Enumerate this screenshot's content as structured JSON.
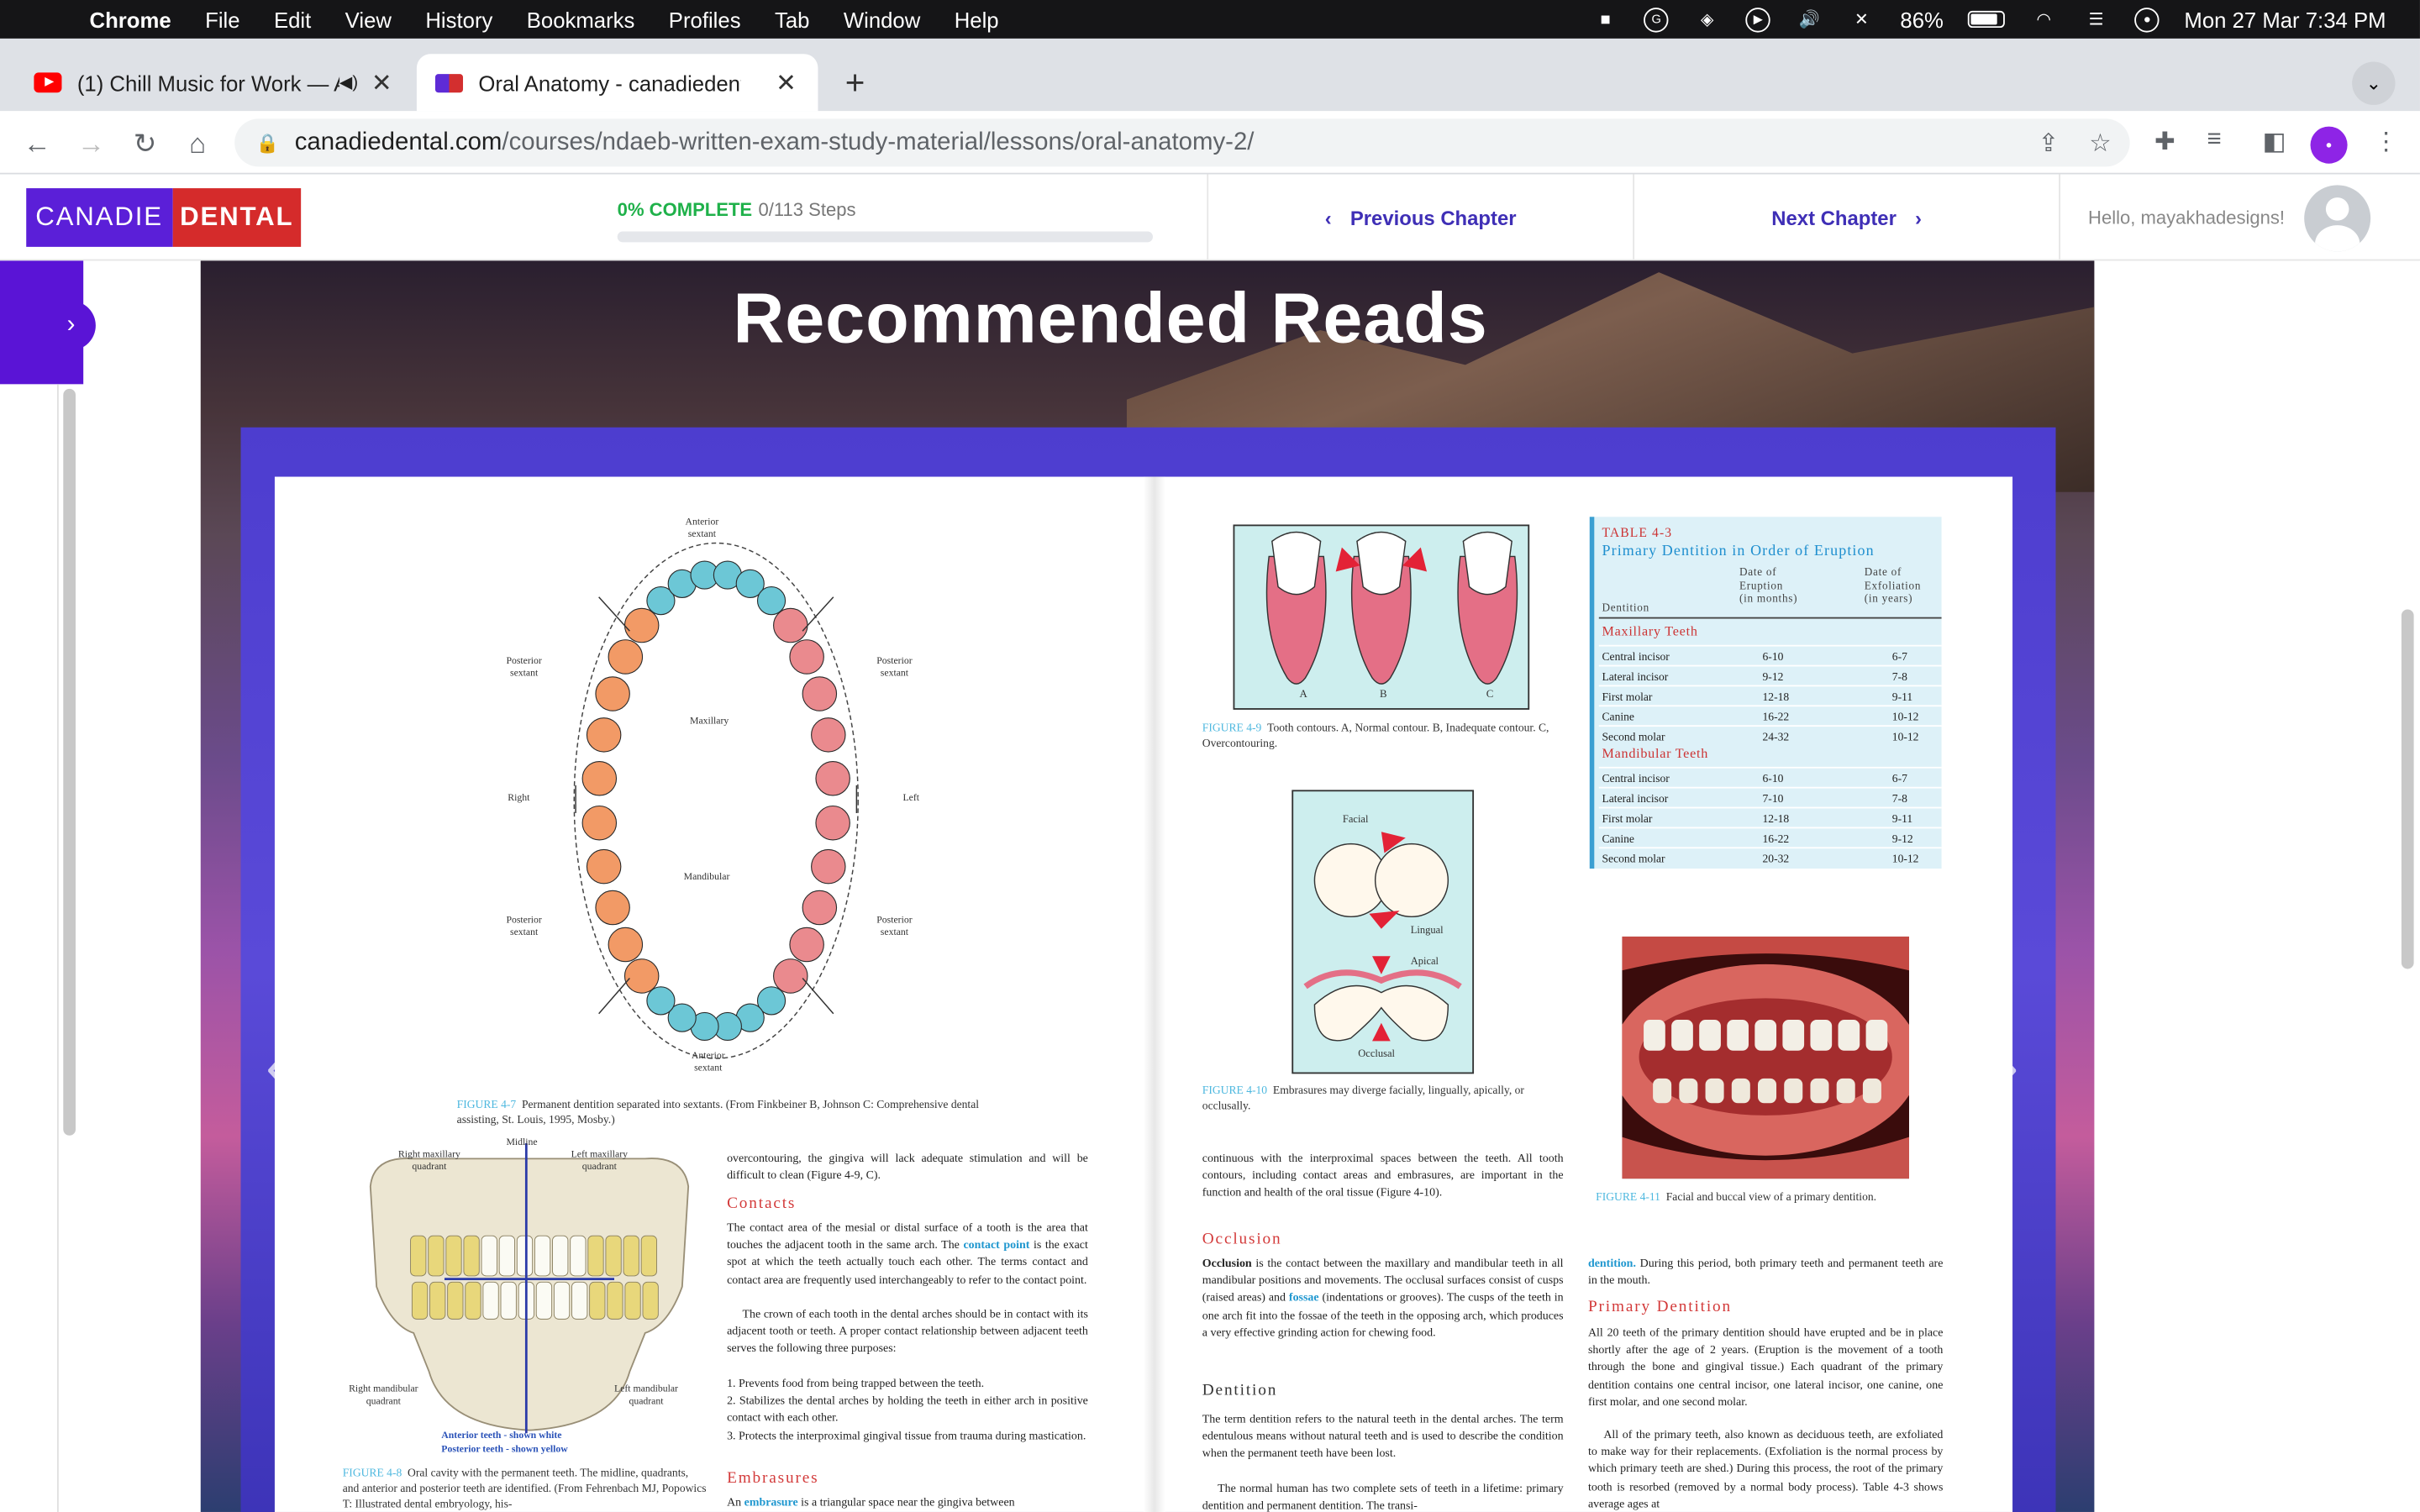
{
  "menubar": {
    "app": "Chrome",
    "items": [
      "File",
      "Edit",
      "View",
      "History",
      "Bookmarks",
      "Profiles",
      "Tab",
      "Window",
      "Help"
    ],
    "battery": "86%",
    "datetime": "Mon 27 Mar  7:34 PM"
  },
  "tabs": [
    {
      "title": "(1) Chill Music for Work — A",
      "active": false
    },
    {
      "title": "Oral Anatomy - canadiedental.c",
      "active": true
    }
  ],
  "address": {
    "domain": "canadiedental.com",
    "path": "/courses/ndaeb-written-exam-study-material/lessons/oral-anatomy-2/"
  },
  "site": {
    "logo_left": "CANADIE",
    "logo_right": "DENTAL",
    "progress_label": "0% COMPLETE",
    "steps": "0/113 Steps",
    "prev": "Previous Chapter",
    "next": "Next Chapter",
    "hello": "Hello, mayakhadesigns!"
  },
  "content": {
    "title": "Recommended Reads"
  },
  "book": {
    "left": {
      "sextant_labels": {
        "anterior_top": "Anterior\nsextant",
        "posterior_tl": "Posterior\nsextant",
        "posterior_tr": "Posterior\nsextant",
        "maxillary": "Maxillary",
        "right": "Right",
        "left": "Left",
        "mandibular": "Mandibular",
        "posterior_bl": "Posterior\nsextant",
        "posterior_br": "Posterior\nsextant",
        "anterior_bottom": "Anterior\nsextant"
      },
      "fig47_label": "FIGURE 4-7",
      "fig47_caption": "Permanent dentition separated into sextants. (From Finkbeiner B, Johnson C: Comprehensive dental assisting, St. Louis, 1995, Mosby.)",
      "fig48_labels": {
        "midline": "Midline",
        "rmq": "Right maxillary\nquadrant",
        "lmq": "Left maxillary\nquadrant",
        "rmdq": "Right mandibular\nquadrant",
        "lmdq": "Left mandibular\nquadrant",
        "anterior": "Anterior teeth - shown white",
        "posterior": "Posterior teeth - shown yellow"
      },
      "fig48_label": "FIGURE 4-8",
      "fig48_caption": "Oral cavity with the permanent teeth. The midline, quadrants, and anterior and posterior teeth are identified. (From Fehrenbach MJ, Popowics T: Illustrated dental embryology, his-",
      "col_text_1": "overcontouring, the gingiva will lack adequate stimulation and will be difficult to clean (Figure 4-9, C).",
      "contacts_heading": "Contacts",
      "contacts_p1_a": "The contact area of the mesial or distal surface of a tooth is the area that touches the adjacent tooth in the same arch. The ",
      "contacts_p1_term": "contact point",
      "contacts_p1_b": " is the exact spot at which the teeth actually touch each other. The terms contact and contact area are frequently used interchangeably to refer to the contact point.",
      "contacts_p2": "The crown of each tooth in the dental arches should be in contact with its adjacent tooth or teeth. A proper contact relationship between adjacent teeth serves the following three purposes:",
      "contacts_list": [
        "1.  Prevents food from being trapped between the teeth.",
        "2.  Stabilizes the dental arches by holding the teeth in either arch in positive contact with each other.",
        "3.  Protects the interproximal gingival tissue from trauma during mastication."
      ],
      "embrasures_heading": "Embrasures",
      "embrasures_a": "An ",
      "embrasures_term": "embrasure",
      "embrasures_b": " is a triangular space near the gingiva between"
    },
    "right": {
      "fig49_letters": [
        "A",
        "B",
        "C"
      ],
      "fig49_label": "FIGURE 4-9",
      "fig49_caption": "Tooth contours. A, Normal contour. B, Inadequate contour. C, Overcontouring.",
      "fig410_labels": {
        "facial": "Facial",
        "lingual": "Lingual",
        "apical": "Apical",
        "occlusal": "Occlusal"
      },
      "fig410_label": "FIGURE 4-10",
      "fig410_caption": "Embrasures may diverge facially, lingually, apically, or occlusally.",
      "col_text_1": "continuous with the interproximal spaces between the teeth. All tooth contours, including contact areas and embrasures, are important in the function and health of the oral tissue (Figure 4-10).",
      "occlusion_heading": "Occlusion",
      "occlusion_term": "Occlusion",
      "occlusion_a": " is the contact between the maxillary and mandibular teeth in all mandibular positions and movements. The occlusal surfaces consist of cusps (raised areas) and ",
      "occlusion_term2": "fossae",
      "occlusion_b": " (indentations or grooves). The cusps of the teeth in one arch fit into the fossae of the teeth in the opposing arch, which produces a very effective grinding action for chewing food.",
      "dentition_heading": "Dentition",
      "dentition_p1": "The term dentition refers to the natural teeth in the dental arches. The term edentulous means without natural teeth and is used to describe the condition when the permanent teeth have been lost.",
      "dentition_p2": "The normal human has two complete sets of teeth in a lifetime: primary dentition and permanent dentition. The transi-",
      "fig411_label": "FIGURE 4-11",
      "fig411_caption": "Facial and buccal view of a primary dentition.",
      "col4_a_term": "dentition.",
      "col4_a": " During this period, both primary teeth and permanent teeth are in the mouth.",
      "primary_heading": "Primary Dentition",
      "primary_p1": "All 20 teeth of the primary dentition should have erupted and be in place shortly after the age of 2 years. (Eruption is the movement of a tooth through the bone and gingival tissue.) Each quadrant of the primary dentition contains one central incisor, one lateral incisor, one canine, one first molar, and one second molar.",
      "primary_p2": "All of the primary teeth, also known as deciduous teeth, are exfoliated to make way for their replacements. (Exfoliation is the normal process by which primary teeth are shed.) During this process, the root of the primary tooth is resorbed (removed by a normal body process). Table 4-3 shows average ages at"
    },
    "table": {
      "number": "TABLE 4-3",
      "title": "Primary Dentition in Order of Eruption",
      "headers": [
        "Dentition",
        "Date of\nEruption\n(in months)",
        "Date of\nExfoliation\n(in years)"
      ],
      "group1": "Maxillary Teeth",
      "rows1": [
        [
          "Central incisor",
          "6-10",
          "6-7"
        ],
        [
          "Lateral incisor",
          "9-12",
          "7-8"
        ],
        [
          "First molar",
          "12-18",
          "9-11"
        ],
        [
          "Canine",
          "16-22",
          "10-12"
        ],
        [
          "Second molar",
          "24-32",
          "10-12"
        ]
      ],
      "group2": "Mandibular Teeth",
      "rows2": [
        [
          "Central incisor",
          "6-10",
          "6-7"
        ],
        [
          "Lateral incisor",
          "7-10",
          "7-8"
        ],
        [
          "First molar",
          "12-18",
          "9-11"
        ],
        [
          "Canine",
          "16-22",
          "9-12"
        ],
        [
          "Second molar",
          "20-32",
          "10-12"
        ]
      ]
    }
  },
  "colors": {
    "brand_purple": "#5b1fd8",
    "brand_red": "#d52b2b",
    "progress_green": "#1fb14a",
    "link_blue": "#3f2fb6"
  }
}
